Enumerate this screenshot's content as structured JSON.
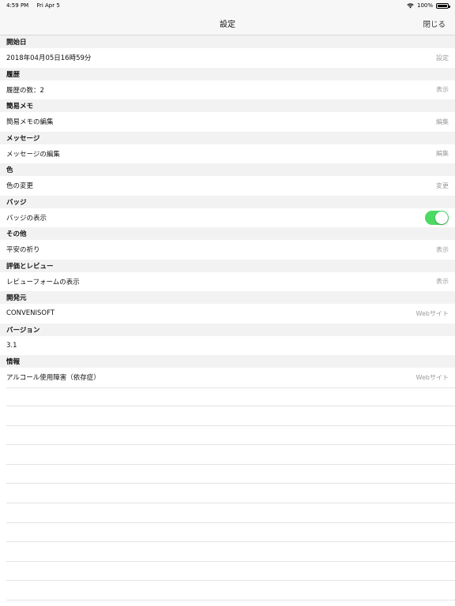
{
  "status_bar": {
    "time": "4:59 PM",
    "date": "Fri Apr 5",
    "battery": "100%"
  },
  "nav": {
    "title": "設定",
    "close_label": "閉じる"
  },
  "sections": [
    {
      "header": "開始日",
      "row_label": "2018年04月05日16時59分",
      "action": "設定"
    },
    {
      "header": "履歴",
      "row_label": "履歴の数：2",
      "action": "表示"
    },
    {
      "header": "簡易メモ",
      "row_label": "簡易メモの編集",
      "action": "編集"
    },
    {
      "header": "メッセージ",
      "row_label": "メッセージの編集",
      "action": "編集"
    },
    {
      "header": "色",
      "row_label": "色の変更",
      "action": "変更"
    },
    {
      "header": "バッジ",
      "row_label": "バッジの表示",
      "toggle_on": true
    },
    {
      "header": "その他",
      "row_label": "平安の祈り",
      "action": "表示"
    },
    {
      "header": "評価とレビュー",
      "row_label": "レビューフォームの表示",
      "action": "表示"
    },
    {
      "header": "開発元",
      "row_label": "CONVENISOFT",
      "action": "Webサイト"
    },
    {
      "header": "バージョン",
      "row_label": "3.1",
      "action": ""
    },
    {
      "header": "情報",
      "row_label": "アルコール使用障害（依存症）",
      "action": "Webサイト"
    }
  ],
  "colors": {
    "toggle_on": "#4cd964",
    "section_bg": "#f2f2f2",
    "secondary_text": "#9b9b9b"
  },
  "icons": [
    "wifi-icon",
    "battery-icon"
  ]
}
